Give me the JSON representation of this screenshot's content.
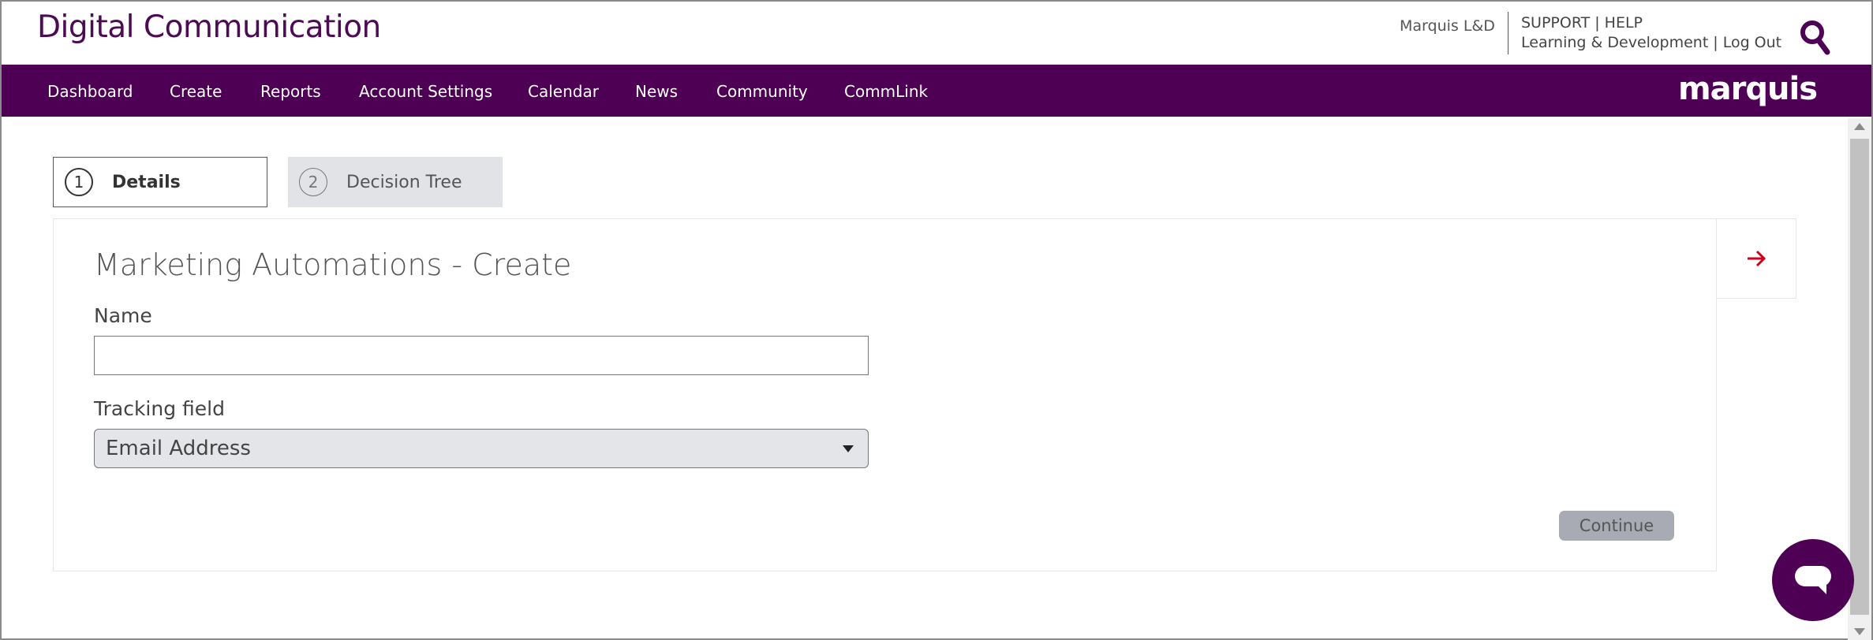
{
  "header": {
    "brand": "Digital Communication",
    "org_name": "Marquis L&D",
    "support": "SUPPORT",
    "help": "HELP",
    "org_link": "Learning & Development",
    "logout": "Log Out",
    "separator": "|"
  },
  "nav": {
    "items": [
      "Dashboard",
      "Create",
      "Reports",
      "Account Settings",
      "Calendar",
      "News",
      "Community",
      "CommLink"
    ],
    "logo": "marquis"
  },
  "steps": [
    {
      "number": "1",
      "label": "Details"
    },
    {
      "number": "2",
      "label": "Decision Tree"
    }
  ],
  "form": {
    "title": "Marketing Automations - Create",
    "name_label": "Name",
    "name_value": "",
    "tracking_label": "Tracking field",
    "tracking_value": "Email Address",
    "continue_label": "Continue"
  },
  "colors": {
    "brand_purple": "#4e0055",
    "arrow_red": "#d0021b"
  }
}
